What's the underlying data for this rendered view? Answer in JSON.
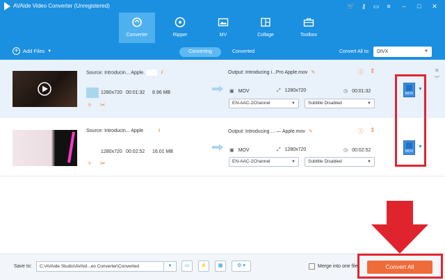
{
  "app": {
    "title": "AVAide Video Converter (Unregistered)"
  },
  "nav": {
    "tabs": [
      {
        "label": "Converter"
      },
      {
        "label": "Ripper"
      },
      {
        "label": "MV"
      },
      {
        "label": "Collage"
      },
      {
        "label": "Toolbox"
      }
    ]
  },
  "toolbar": {
    "add_files": "Add Files",
    "seg_converting": "Converting",
    "seg_converted": "Converted",
    "convert_all_to": "Convert All to:",
    "format": "DIVX"
  },
  "files": [
    {
      "source": "Source: Introducin... Apple.",
      "resolution": "1280x720",
      "duration": "00:01:32",
      "size": "8.96 MB",
      "output": "Output: Introducing i...Pro Apple.mov",
      "out_format": "MOV",
      "out_resolution": "1280x720",
      "out_duration": "00:01:32",
      "audio": "EN-AAC-2Channel",
      "subtitle": "Subtitle Disabled",
      "format_badge": "MOV"
    },
    {
      "source": "Source: Introducin... Apple",
      "resolution": "1280x720",
      "duration": "00:02:52",
      "size": "16.01 MB",
      "output": "Output: Introducing ... — Apple.mov",
      "out_format": "MOV",
      "out_resolution": "1280x720",
      "out_duration": "00:02:52",
      "audio": "EN-AAC-2Channel",
      "subtitle": "Subtitle Disabled",
      "format_badge": "MOV"
    }
  ],
  "footer": {
    "save_to_label": "Save to:",
    "path": "C:\\AVAide Studio\\AVAid...eo Converter\\Converted",
    "merge_label": "Merge into one file",
    "convert_all": "Convert All"
  },
  "colors": {
    "accent": "#1b8fe0",
    "convert_button": "#f06b3a",
    "highlight_red": "#e0242d"
  }
}
